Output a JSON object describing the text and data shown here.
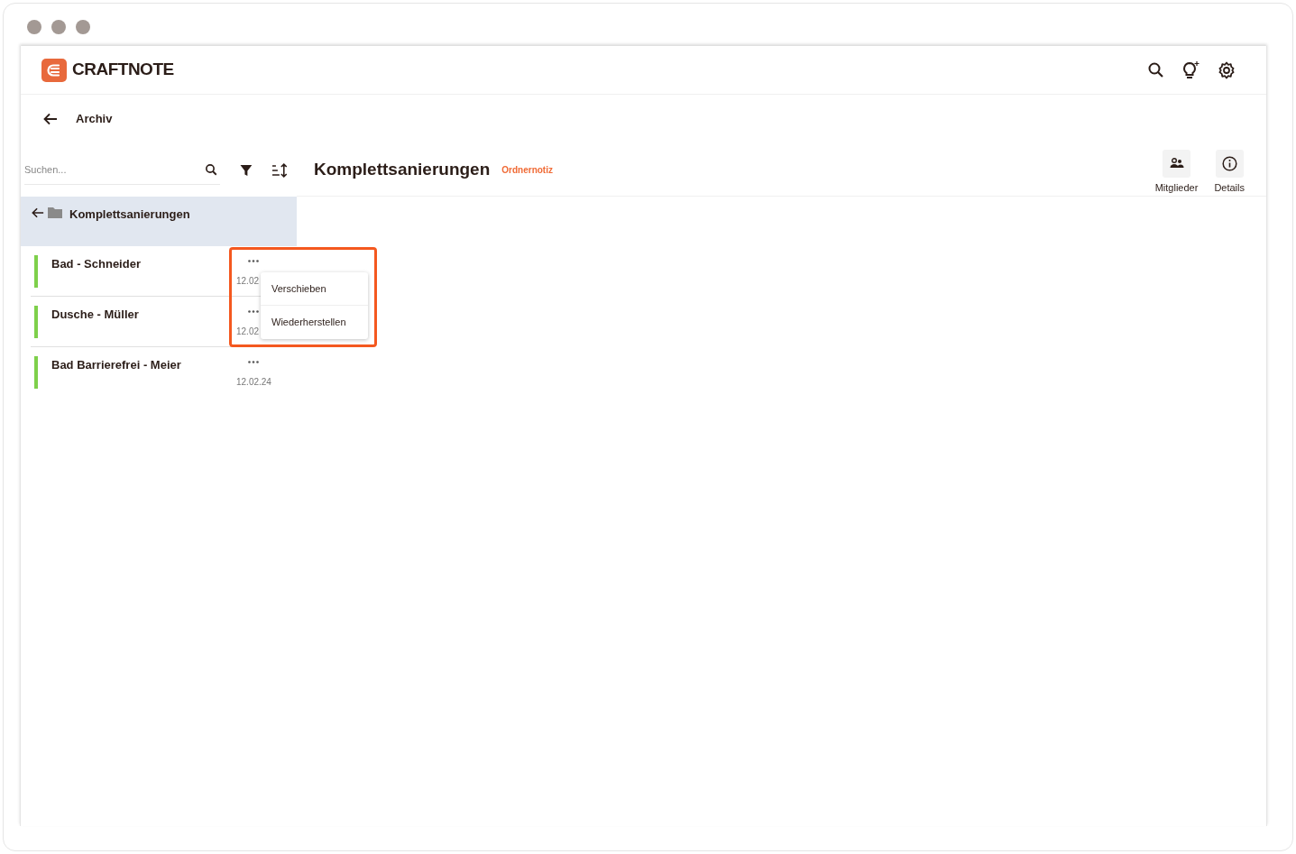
{
  "app": {
    "name": "CRAFTNOTE"
  },
  "back": {
    "label": "Archiv"
  },
  "search": {
    "placeholder": "Suchen..."
  },
  "folder": {
    "name": "Komplettsanierungen"
  },
  "projects": [
    {
      "name": "Bad - Schneider",
      "date": "12.02",
      "color": "#7ed04b",
      "menu_open": true
    },
    {
      "name": "Dusche - Müller",
      "date": "12.02",
      "color": "#7ed04b",
      "menu_open": false
    },
    {
      "name": "Bad Barrierefrei - Meier",
      "date": "12.02.24",
      "color": "#7ed04b",
      "menu_open": false
    }
  ],
  "context_menu": {
    "items": [
      "Verschieben",
      "Wiederherstellen"
    ],
    "highlighted": true
  },
  "header": {
    "title": "Komplettsanierungen",
    "link": "Ordnernotiz",
    "actions": [
      {
        "kind": "members",
        "label": "Mitglieder"
      },
      {
        "kind": "details",
        "label": "Details"
      }
    ]
  }
}
